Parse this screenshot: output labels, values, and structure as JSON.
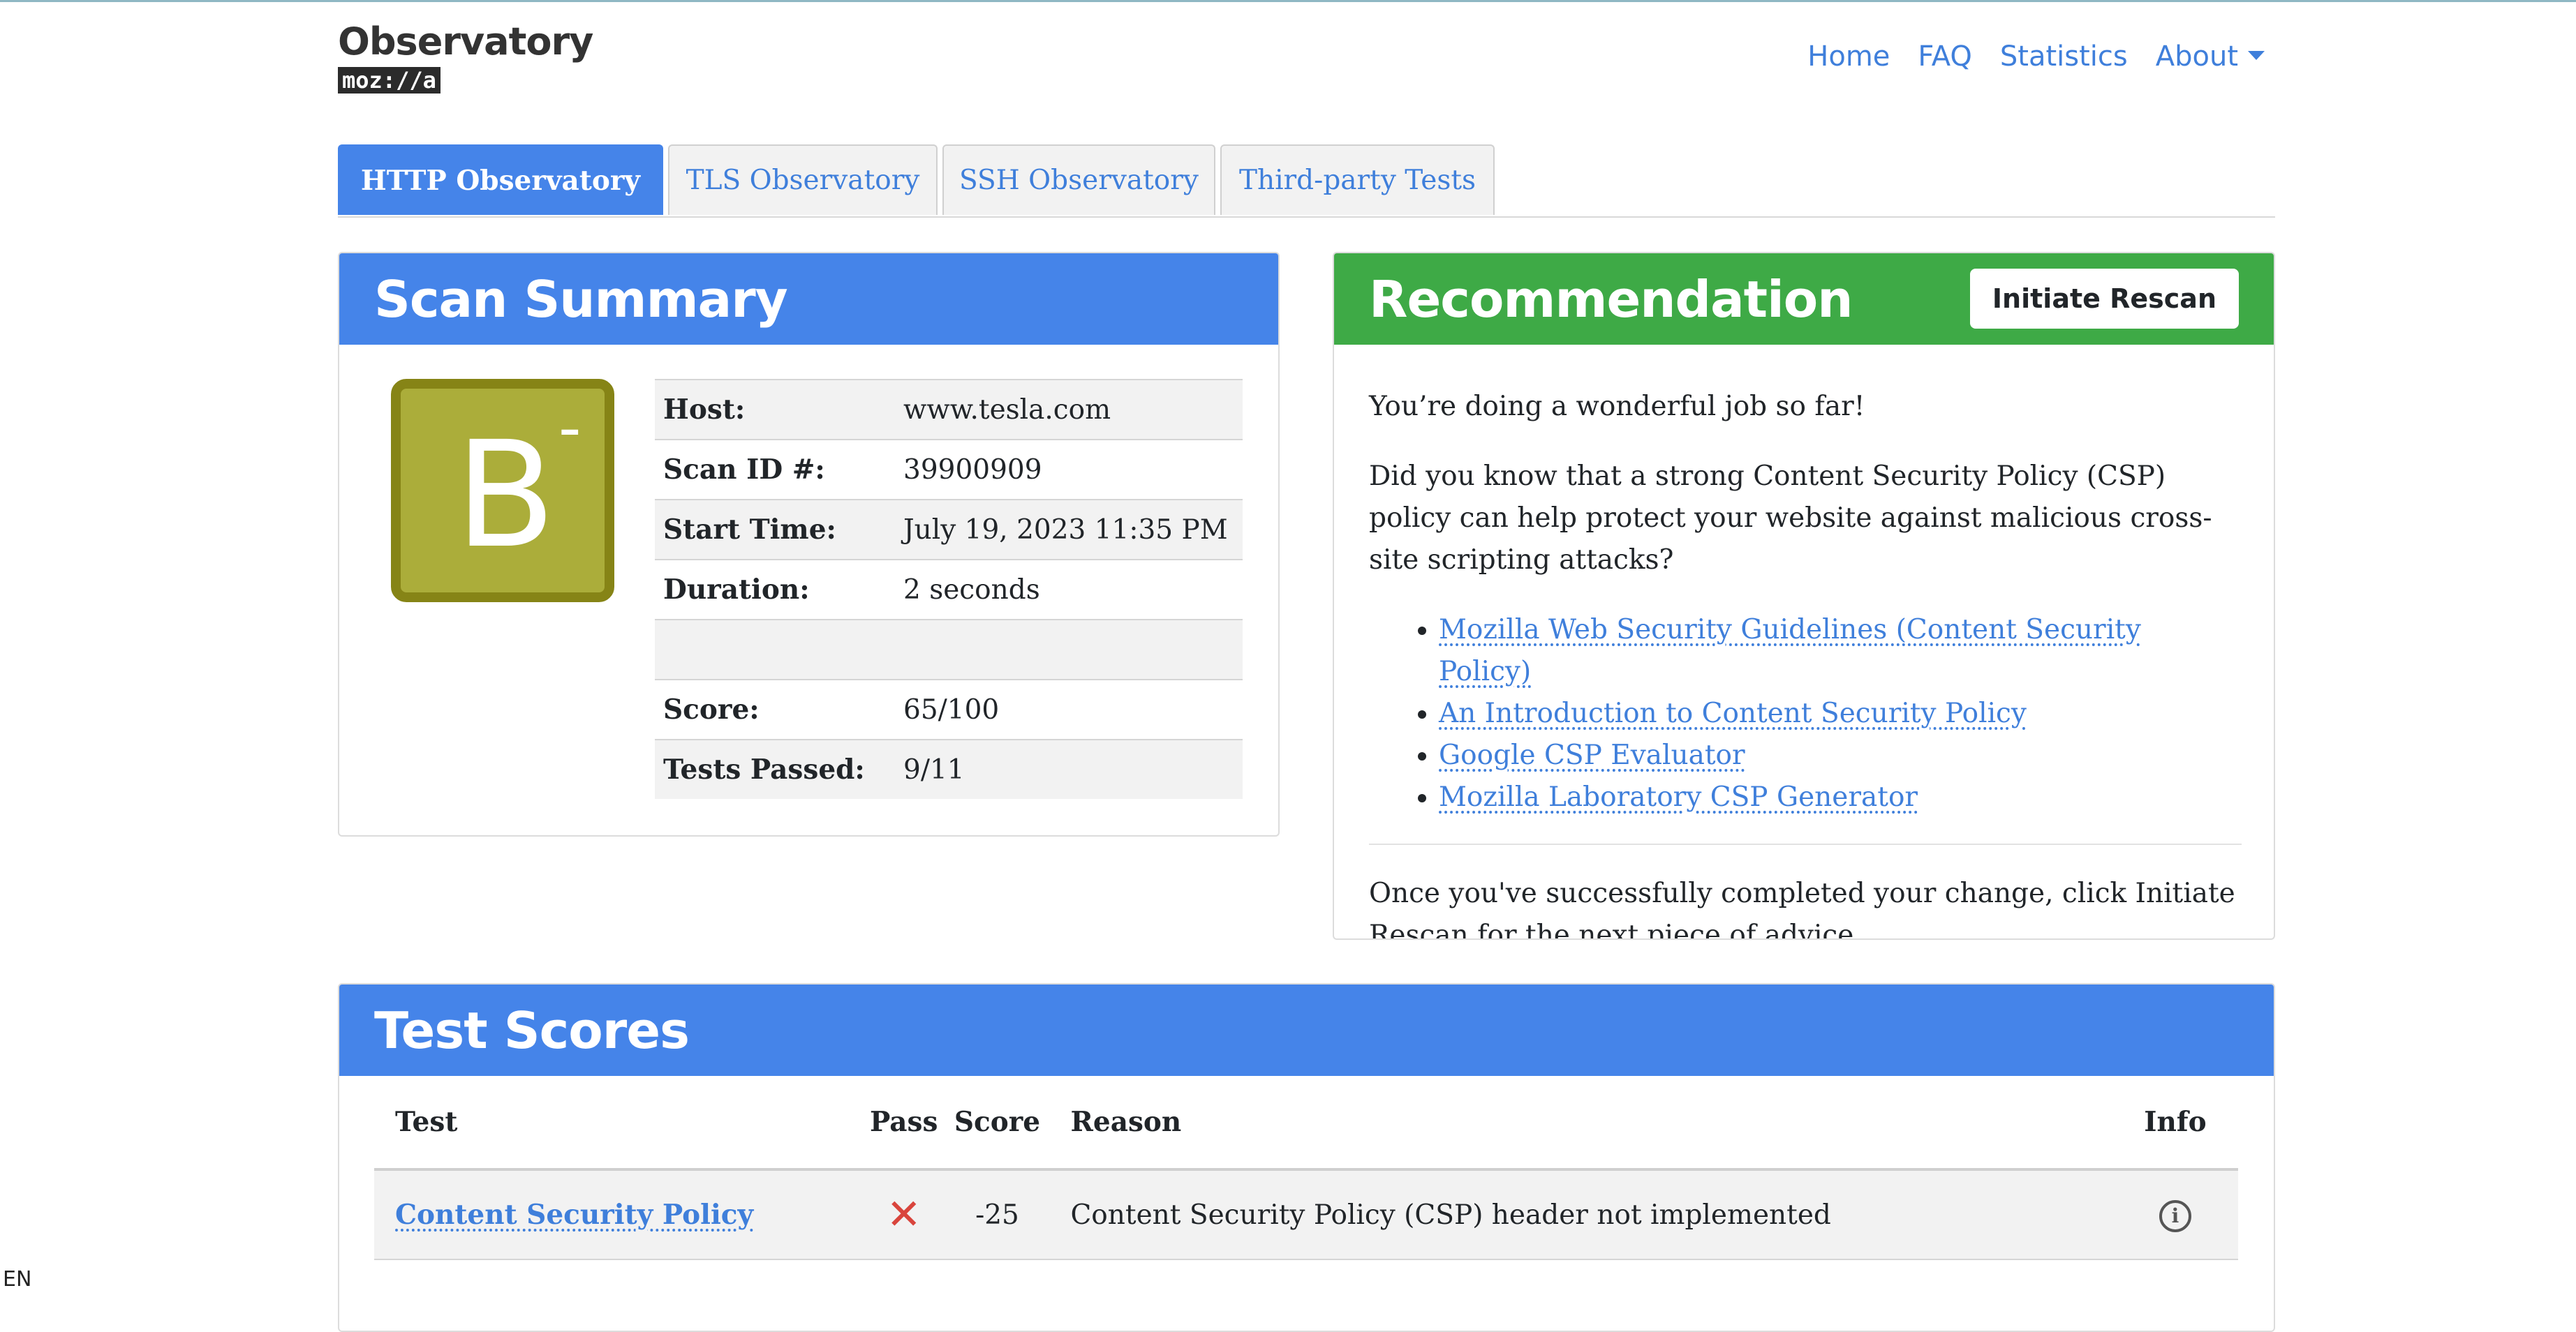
{
  "brand": {
    "title": "Observatory",
    "subtitle": "moz://a"
  },
  "nav": {
    "home": "Home",
    "faq": "FAQ",
    "statistics": "Statistics",
    "about": "About"
  },
  "tabs": [
    "HTTP Observatory",
    "TLS Observatory",
    "SSH Observatory",
    "Third-party Tests"
  ],
  "scan_summary": {
    "title": "Scan Summary",
    "grade": {
      "letter": "B",
      "modifier": "-",
      "color": "#abad3a"
    },
    "rows": [
      {
        "key": "Host:",
        "value": "www.tesla.com"
      },
      {
        "key": "Scan ID #:",
        "value": "39900909"
      },
      {
        "key": "Start Time:",
        "value": "July 19, 2023 11:35 PM"
      },
      {
        "key": "Duration:",
        "value": "2 seconds"
      },
      {
        "key": "",
        "value": ""
      },
      {
        "key": "Score:",
        "value": "65/100"
      },
      {
        "key": "Tests Passed:",
        "value": "9/11"
      }
    ]
  },
  "recommendation": {
    "title": "Recommendation",
    "rescan_label": "Initiate Rescan",
    "intro": "You’re doing a wonderful job so far!",
    "body": "Did you know that a strong Content Security Policy (CSP) policy can help protect your website against malicious cross-site scripting attacks?",
    "links": [
      "Mozilla Web Security Guidelines (Content Security Policy)",
      "An Introduction to Content Security Policy",
      "Google CSP Evaluator",
      "Mozilla Laboratory CSP Generator"
    ],
    "footer": "Once you've successfully completed your change, click Initiate Rescan for the next piece of advice."
  },
  "test_scores": {
    "title": "Test Scores",
    "headers": {
      "test": "Test",
      "pass": "Pass",
      "score": "Score",
      "reason": "Reason",
      "info": "Info"
    },
    "rows": [
      {
        "test": "Content Security Policy",
        "pass": "✕",
        "score": "-25",
        "reason": "Content Security Policy (CSP) header not implemented"
      }
    ]
  },
  "colors": {
    "accent": "#4584e9",
    "success": "#3eaa46",
    "fail": "#d9453d",
    "link": "#3f7fdb"
  },
  "locale": "EN"
}
